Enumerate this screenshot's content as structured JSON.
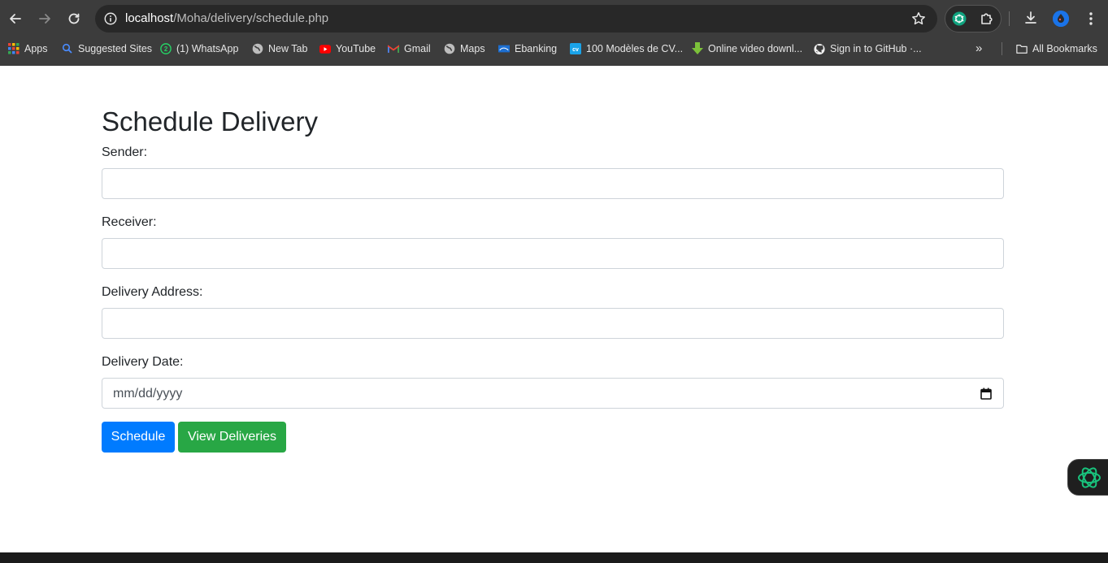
{
  "browser": {
    "url_host": "localhost",
    "url_path": "/Moha/delivery/schedule.php",
    "bookmarks": [
      {
        "label": "Apps",
        "icon": "apps-grid-icon"
      },
      {
        "label": "Suggested Sites",
        "icon": "search-icon"
      },
      {
        "label": "(1) WhatsApp",
        "icon": "whatsapp-icon"
      },
      {
        "label": "New Tab",
        "icon": "globe-icon"
      },
      {
        "label": "YouTube",
        "icon": "youtube-icon"
      },
      {
        "label": "Gmail",
        "icon": "gmail-icon"
      },
      {
        "label": "Maps",
        "icon": "globe-icon"
      },
      {
        "label": "Ebanking",
        "icon": "bank-icon"
      },
      {
        "label": "100 Modèles de CV...",
        "icon": "cv-icon"
      },
      {
        "label": "Online video downl...",
        "icon": "download-arrow-icon"
      },
      {
        "label": "Sign in to GitHub ·...",
        "icon": "github-icon"
      }
    ],
    "more_bookmarks": "»",
    "all_bookmarks": "All Bookmarks"
  },
  "page": {
    "title": "Schedule Delivery",
    "fields": {
      "sender_label": "Sender:",
      "receiver_label": "Receiver:",
      "address_label": "Delivery Address:",
      "date_label": "Delivery Date:",
      "date_placeholder": "mm/dd/yyyy"
    },
    "buttons": {
      "schedule": "Schedule",
      "view": "View Deliveries"
    }
  },
  "colors": {
    "primary": "#007bff",
    "success": "#28a745",
    "chrome_bg": "#3c3c3c"
  }
}
